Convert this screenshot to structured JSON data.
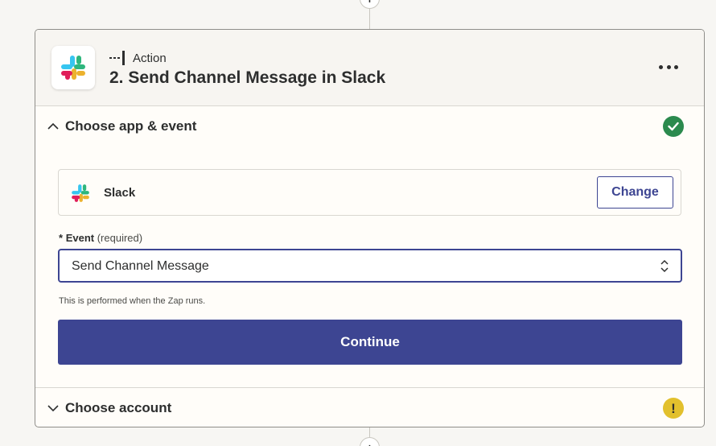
{
  "step": {
    "type_label": "Action",
    "title": "2. Send Channel Message in Slack",
    "app_icon": "slack-logo",
    "more_icon": "more-horizontal-icon"
  },
  "section_app_event": {
    "title": "Choose app & event",
    "status": "complete",
    "status_color": "#2b8a4e",
    "expanded": true,
    "app": {
      "name": "Slack",
      "change_label": "Change"
    },
    "event": {
      "required_marker": "*",
      "label": "Event",
      "required_hint": "(required)",
      "value": "Send Channel Message",
      "help": "This is performed when the Zap runs."
    },
    "continue_label": "Continue"
  },
  "section_account": {
    "title": "Choose account",
    "status": "warning",
    "status_color": "#e2c02d",
    "expanded": false
  },
  "colors": {
    "accent": "#3d4592",
    "background": "#f7f6f3",
    "card": "#fffdf9"
  }
}
